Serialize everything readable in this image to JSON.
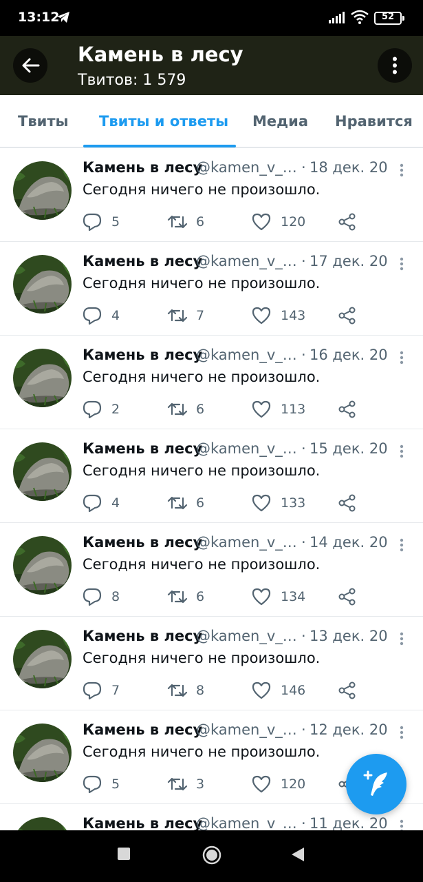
{
  "status_bar": {
    "time": "13:12",
    "battery": "52"
  },
  "header": {
    "title": "Камень в лесу",
    "tweet_count": "Твитов: 1 579"
  },
  "tabs": [
    {
      "label": "Твиты",
      "active": false
    },
    {
      "label": "Твиты и ответы",
      "active": true
    },
    {
      "label": "Медиа",
      "active": false
    },
    {
      "label": "Нравится",
      "active": false
    }
  ],
  "tweets": [
    {
      "author": "Камень в лесу",
      "handle": "@kamen_v_lesu",
      "date": "18 дек. 20",
      "text": "Сегодня ничего не произошло.",
      "replies": "5",
      "retweets": "6",
      "likes": "120"
    },
    {
      "author": "Камень в лесу",
      "handle": "@kamen_v_lesu",
      "date": "17 дек. 20",
      "text": "Сегодня ничего не произошло.",
      "replies": "4",
      "retweets": "7",
      "likes": "143"
    },
    {
      "author": "Камень в лесу",
      "handle": "@kamen_v_lesu",
      "date": "16 дек. 20",
      "text": "Сегодня ничего не произошло.",
      "replies": "2",
      "retweets": "6",
      "likes": "113"
    },
    {
      "author": "Камень в лесу",
      "handle": "@kamen_v_lesu",
      "date": "15 дек. 20",
      "text": "Сегодня ничего не произошло.",
      "replies": "4",
      "retweets": "6",
      "likes": "133"
    },
    {
      "author": "Камень в лесу",
      "handle": "@kamen_v_lesu",
      "date": "14 дек. 20",
      "text": "Сегодня ничего не произошло.",
      "replies": "8",
      "retweets": "6",
      "likes": "134"
    },
    {
      "author": "Камень в лесу",
      "handle": "@kamen_v_lesu",
      "date": "13 дек. 20",
      "text": "Сегодня ничего не произошло.",
      "replies": "7",
      "retweets": "8",
      "likes": "146"
    },
    {
      "author": "Камень в лесу",
      "handle": "@kamen_v_lesu",
      "date": "12 дек. 20",
      "text": "Сегодня ничего не произошло.",
      "replies": "5",
      "retweets": "3",
      "likes": "120"
    },
    {
      "author": "Камень в лесу",
      "handle": "@kamen_v_lesu",
      "date": "11 дек. 20",
      "text": "",
      "replies": "",
      "retweets": "",
      "likes": ""
    }
  ],
  "icons": {
    "back": "arrow-left-icon",
    "more": "more-vertical-icon",
    "reply": "reply-icon",
    "retweet": "retweet-icon",
    "like": "heart-icon",
    "share": "share-icon",
    "compose": "compose-tweet-icon"
  },
  "colors": {
    "accent": "#1d9bf0",
    "header_bg": "#1f2316",
    "secondary_text": "#536471"
  }
}
